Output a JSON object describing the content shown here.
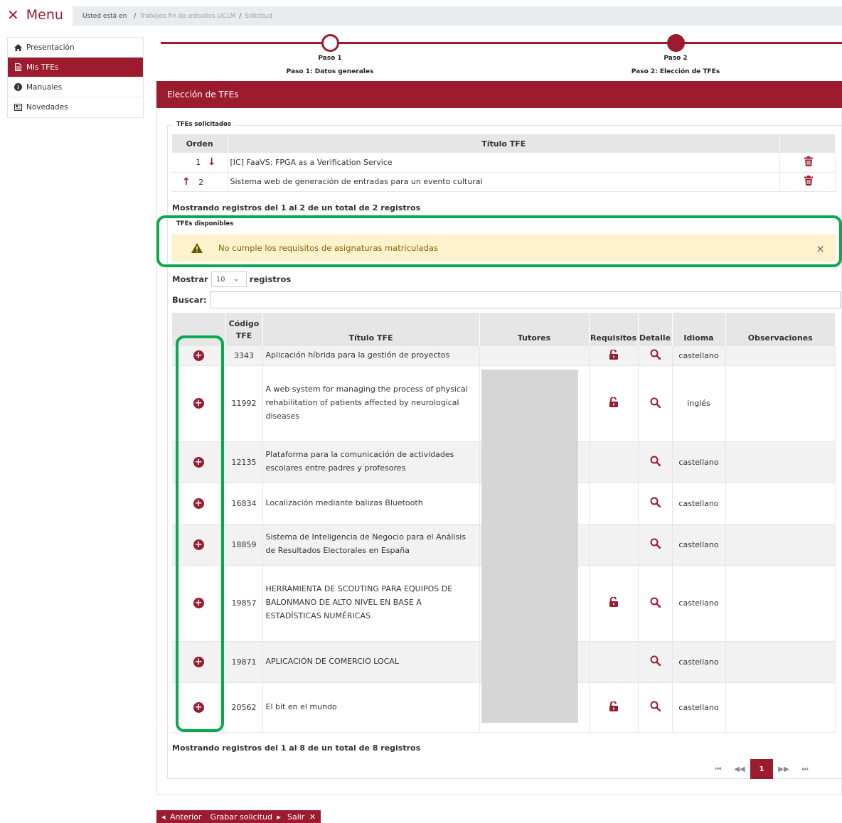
{
  "header": {
    "menu_icon": "close-icon",
    "menu_label": "Menu",
    "breadcrumb_lead": "Usted está en",
    "breadcrumb": [
      "Trabajos fin de estudios UCLM",
      "Solicitud"
    ]
  },
  "sidebar": {
    "items": [
      {
        "label": "Presentación",
        "icon": "home-icon"
      },
      {
        "label": "Mis TFEs",
        "icon": "file-icon",
        "active": true
      },
      {
        "label": "Manuales",
        "icon": "info-icon"
      },
      {
        "label": "Novedades",
        "icon": "newspaper-icon"
      }
    ]
  },
  "steps": [
    {
      "label": "Paso 1",
      "title": "Paso 1: Datos generales",
      "state": "current"
    },
    {
      "label": "Paso 2",
      "title": "Paso 2: Elección de TFEs",
      "state": "completed"
    }
  ],
  "panel": {
    "title": "Elección de TFEs"
  },
  "requested": {
    "legend": "TFEs solicitados",
    "headers": {
      "order": "Orden",
      "title": "Título TFE"
    },
    "rows": [
      {
        "order": "1",
        "title": "[IC] FaaVS: FPGA as a Verification Service"
      },
      {
        "order": "2",
        "title": "Sistema web de generación de entradas para un evento cultural"
      }
    ],
    "info": "Mostrando registros del 1 al 2 de un total de 2 registros"
  },
  "available": {
    "legend": "TFEs disponibles",
    "alert": "No cumple los requisitos de asignaturas matriculadas",
    "length_label_pre": "Mostrar",
    "length_value": "10",
    "length_label_post": "registros",
    "search_label": "Buscar:",
    "search_value": "",
    "headers": {
      "code_1": "Código",
      "code_2": "TFE",
      "title": "Título TFE",
      "tutors": "Tutores",
      "requirements": "Requisitos",
      "detail": "Detalle",
      "language": "Idioma",
      "observations": "Observaciones"
    },
    "rows": [
      {
        "code": "3343",
        "title": "Aplicación híbrida para la gestión de proyectos",
        "lock": true,
        "language": "castellano"
      },
      {
        "code": "11992",
        "title": "A web system for managing the process of physical rehabilitation of patients affected by neurological diseases",
        "lock": true,
        "language": "inglés"
      },
      {
        "code": "12135",
        "title": "Plataforma para la comunicación de actividades escolares entre padres y profesores",
        "lock": false,
        "language": "castellano"
      },
      {
        "code": "16834",
        "title": "Localización mediante balizas Bluetooth",
        "lock": false,
        "language": "castellano"
      },
      {
        "code": "18859",
        "title": "Sistema de Inteligencia de Negocio para el Análisis de Resultados Electorales en España",
        "lock": false,
        "language": "castellano"
      },
      {
        "code": "19857",
        "title": "HERRAMIENTA DE SCOUTING PARA EQUIPOS DE BALONMANO DE ALTO NIVEL EN BASE A ESTADÍSTICAS NUMÉRICAS",
        "lock": true,
        "language": "castellano"
      },
      {
        "code": "19871",
        "title": "APLICACIÓN DE COMERCIO LOCAL",
        "lock": false,
        "language": "castellano"
      },
      {
        "code": "20562",
        "title": "El bit en el mundo",
        "lock": true,
        "language": "castellano"
      }
    ],
    "info": "Mostrando registros del 1 al 8 de un total de 8 registros",
    "current_page": "1"
  },
  "footer_buttons": {
    "previous": "Anterior",
    "save": "Grabar solicitud",
    "exit": "Salir"
  },
  "colors": {
    "accent": "#9c1b2e",
    "highlight": "#0aa84f",
    "alert_bg": "#fff3cd",
    "alert_text": "#856404"
  }
}
